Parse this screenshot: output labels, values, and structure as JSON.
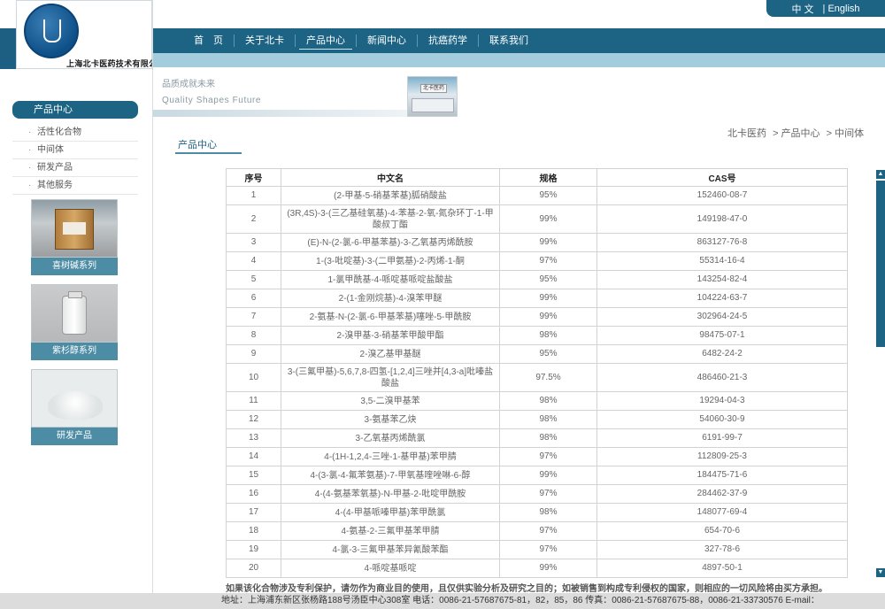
{
  "header": {
    "logo_arc_text": "NorthCarolina Chemicals",
    "logo_company": "上海北卡医药技术有限公司",
    "lang": [
      "中 文",
      "| English"
    ]
  },
  "nav": {
    "items": [
      "首　页",
      "关于北卡",
      "产品中心",
      "新闻中心",
      "抗癌药学",
      "联系我们"
    ],
    "active": "产品中心"
  },
  "banner": {
    "slogan_cn": "品质成就未来",
    "slogan_en": "Quality  Shapes  Future",
    "sign": "北卡医药"
  },
  "sidebar": {
    "title": "产品中心",
    "items": [
      "活性化合物",
      "中间体",
      "研发产品",
      "其他服务"
    ],
    "products": [
      "喜树碱系列",
      "紫杉醇系列",
      "研发产品"
    ]
  },
  "main": {
    "title": "产品中心",
    "breadcrumb": [
      "北卡医药",
      "> 产品中心",
      "> 中间体"
    ]
  },
  "table": {
    "headers": [
      "序号",
      "中文名",
      "规格",
      "CAS号"
    ],
    "rows": [
      [
        "1",
        "(2-甲基-5-硝基苯基)胍硝酸盐",
        "95%",
        "152460-08-7"
      ],
      [
        "2",
        "(3R,4S)-3-(三乙基硅氧基)-4-苯基-2-氧-氮杂环丁-1-甲酸叔丁酯",
        "99%",
        "149198-47-0"
      ],
      [
        "3",
        "(E)-N-(2-氯-6-甲基苯基)-3-乙氧基丙烯酰胺",
        "99%",
        "863127-76-8"
      ],
      [
        "4",
        "1-(3-吡啶基)-3-(二甲氨基)-2-丙烯-1-酮",
        "97%",
        "55314-16-4"
      ],
      [
        "5",
        "1-氯甲酰基-4-哌啶基哌啶盐酸盐",
        "95%",
        "143254-82-4"
      ],
      [
        "6",
        "2-(1-金刚烷基)-4-溴苯甲醚",
        "99%",
        "104224-63-7"
      ],
      [
        "7",
        "2-氨基-N-(2-氯-6-甲基苯基)噻唑-5-甲酰胺",
        "99%",
        "302964-24-5"
      ],
      [
        "8",
        "2-溴甲基-3-硝基苯甲酸甲酯",
        "98%",
        "98475-07-1"
      ],
      [
        "9",
        "2-溴乙基甲基醚",
        "95%",
        "6482-24-2"
      ],
      [
        "10",
        "3-(三氟甲基)-5,6,7,8-四氢-[1,2,4]三唑并[4,3-a]吡嗪盐酸盐",
        "97.5%",
        "486460-21-3"
      ],
      [
        "11",
        "3,5-二溴甲基苯",
        "98%",
        "19294-04-3"
      ],
      [
        "12",
        "3-氨基苯乙炔",
        "98%",
        "54060-30-9"
      ],
      [
        "13",
        "3-乙氧基丙烯酰氯",
        "98%",
        "6191-99-7"
      ],
      [
        "14",
        "4-(1H-1,2,4-三唑-1-基甲基)苯甲腈",
        "97%",
        "112809-25-3"
      ],
      [
        "15",
        "4-(3-氯-4-氟苯氨基)-7-甲氧基喹唑啉-6-醇",
        "99%",
        "184475-71-6"
      ],
      [
        "16",
        "4-(4-氨基苯氧基)-N-甲基-2-吡啶甲酰胺",
        "97%",
        "284462-37-9"
      ],
      [
        "17",
        "4-(4-甲基哌嗪甲基)苯甲酰氯",
        "98%",
        "148077-69-4"
      ],
      [
        "18",
        "4-氨基-2-三氟甲基苯甲腈",
        "97%",
        "654-70-6"
      ],
      [
        "19",
        "4-氯-3-三氟甲基苯异氰酸苯酯",
        "97%",
        "327-78-6"
      ],
      [
        "20",
        "4-哌啶基哌啶",
        "99%",
        "4897-50-1"
      ]
    ]
  },
  "disclaimer": "如果该化合物涉及专利保护，请勿作为商业目的使用，且仅供实验分析及研究之目的；如被销售到构成专利侵权的国家，则相应的一切风险将由买方承担。",
  "footer": "地址：上海浦东新区张杨路188号汤臣中心308室  电话：0086-21-57687675-81，82，85，86 传真：0086-21-57687675-88，0086-21-33730576 E-mail：",
  "colors": {
    "primary": "#1c6384",
    "accent": "#4c8ca5",
    "band": "#a3cddc"
  }
}
